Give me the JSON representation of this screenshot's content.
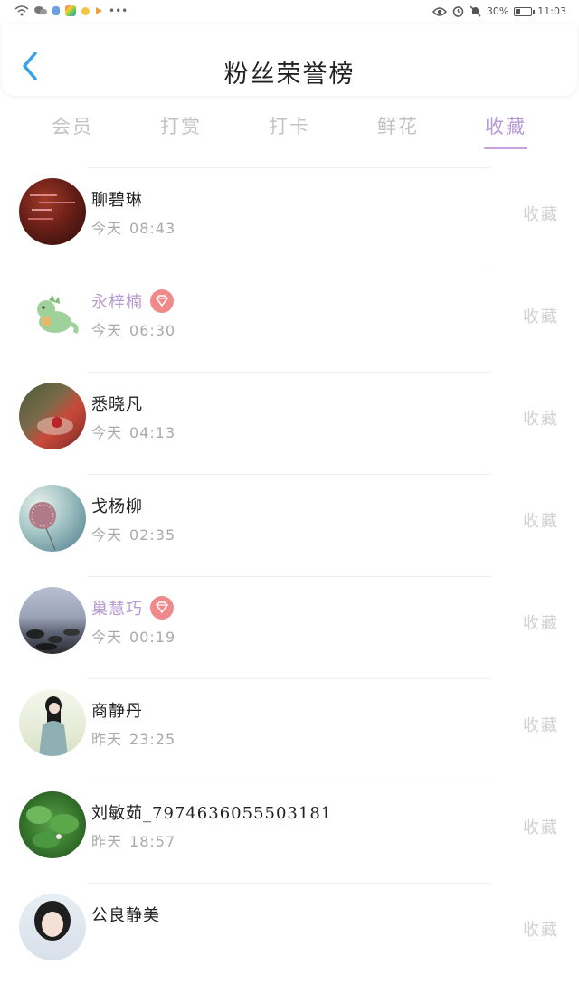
{
  "status_bar": {
    "battery": "30%",
    "time": "11:03"
  },
  "header": {
    "title": "粉丝荣誉榜"
  },
  "tabs": [
    {
      "label": "会员",
      "active": false
    },
    {
      "label": "打赏",
      "active": false
    },
    {
      "label": "打卡",
      "active": false
    },
    {
      "label": "鲜花",
      "active": false
    },
    {
      "label": "收藏",
      "active": true
    }
  ],
  "colors": {
    "accent": "#b69ad6",
    "vip_name": "#b89ad4",
    "vip_badge": "#f08a8a",
    "muted": "#aaaaaa"
  },
  "fans": [
    {
      "name": "聊碧琳",
      "vip": false,
      "day": "今天",
      "time": "08:43",
      "action": "收藏"
    },
    {
      "name": "永梓楠",
      "vip": true,
      "day": "今天",
      "time": "06:30",
      "action": "收藏"
    },
    {
      "name": "悉晓凡",
      "vip": false,
      "day": "今天",
      "time": "04:13",
      "action": "收藏"
    },
    {
      "name": "戈杨柳",
      "vip": false,
      "day": "今天",
      "time": "02:35",
      "action": "收藏"
    },
    {
      "name": "巢慧巧",
      "vip": true,
      "day": "今天",
      "time": "00:19",
      "action": "收藏"
    },
    {
      "name": "商静丹",
      "vip": false,
      "day": "昨天",
      "time": "23:25",
      "action": "收藏"
    },
    {
      "name": "刘敏茹_7974636055503181",
      "vip": false,
      "day": "昨天",
      "time": "18:57",
      "action": "收藏"
    },
    {
      "name": "公良静美",
      "vip": false,
      "day": "",
      "time": "",
      "action": "收藏"
    }
  ]
}
